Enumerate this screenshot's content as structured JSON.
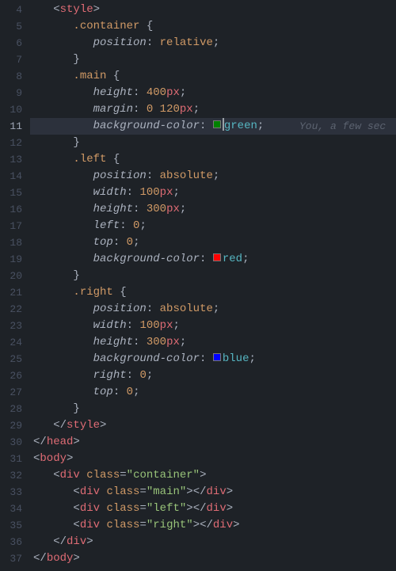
{
  "gutter": {
    "start": 4,
    "end": 37,
    "active_line": 11
  },
  "blame": {
    "text": "You, a few sec"
  },
  "lines": [
    {
      "n": 4,
      "i": 1,
      "seg": [
        [
          "t-punc",
          "<"
        ],
        [
          "t-tag",
          "style"
        ],
        [
          "t-punc",
          ">"
        ]
      ]
    },
    {
      "n": 5,
      "i": 2,
      "seg": [
        [
          "t-sel",
          ".container"
        ],
        [
          "t-punc",
          " {"
        ]
      ]
    },
    {
      "n": 6,
      "i": 3,
      "seg": [
        [
          "t-prop",
          "position"
        ],
        [
          "t-punc",
          ": "
        ],
        [
          "t-val",
          "relative"
        ],
        [
          "t-punc",
          ";"
        ]
      ]
    },
    {
      "n": 7,
      "i": 2,
      "seg": [
        [
          "t-punc",
          "}"
        ]
      ]
    },
    {
      "n": 8,
      "i": 2,
      "seg": [
        [
          "t-sel",
          ".main"
        ],
        [
          "t-punc",
          " {"
        ]
      ]
    },
    {
      "n": 9,
      "i": 3,
      "seg": [
        [
          "t-prop",
          "height"
        ],
        [
          "t-punc",
          ": "
        ],
        [
          "t-num",
          "400"
        ],
        [
          "t-unit",
          "px"
        ],
        [
          "t-punc",
          ";"
        ]
      ]
    },
    {
      "n": 10,
      "i": 3,
      "seg": [
        [
          "t-prop",
          "margin"
        ],
        [
          "t-punc",
          ": "
        ],
        [
          "t-num",
          "0 120"
        ],
        [
          "t-unit",
          "px"
        ],
        [
          "t-punc",
          ";"
        ]
      ]
    },
    {
      "n": 11,
      "i": 3,
      "highlight": true,
      "seg": [
        [
          "t-prop",
          "background-color"
        ],
        [
          "t-punc",
          ": "
        ],
        [
          "swatch",
          "sw-green"
        ],
        [
          "cursor",
          ""
        ],
        [
          "t-color",
          "green"
        ],
        [
          "t-punc",
          ";"
        ]
      ],
      "blame": true
    },
    {
      "n": 12,
      "i": 2,
      "seg": [
        [
          "t-punc",
          "}"
        ]
      ]
    },
    {
      "n": 13,
      "i": 2,
      "seg": [
        [
          "t-sel",
          ".left"
        ],
        [
          "t-punc",
          " {"
        ]
      ]
    },
    {
      "n": 14,
      "i": 3,
      "seg": [
        [
          "t-prop",
          "position"
        ],
        [
          "t-punc",
          ": "
        ],
        [
          "t-val",
          "absolute"
        ],
        [
          "t-punc",
          ";"
        ]
      ]
    },
    {
      "n": 15,
      "i": 3,
      "seg": [
        [
          "t-prop",
          "width"
        ],
        [
          "t-punc",
          ": "
        ],
        [
          "t-num",
          "100"
        ],
        [
          "t-unit",
          "px"
        ],
        [
          "t-punc",
          ";"
        ]
      ]
    },
    {
      "n": 16,
      "i": 3,
      "seg": [
        [
          "t-prop",
          "height"
        ],
        [
          "t-punc",
          ": "
        ],
        [
          "t-num",
          "300"
        ],
        [
          "t-unit",
          "px"
        ],
        [
          "t-punc",
          ";"
        ]
      ]
    },
    {
      "n": 17,
      "i": 3,
      "seg": [
        [
          "t-prop",
          "left"
        ],
        [
          "t-punc",
          ": "
        ],
        [
          "t-num",
          "0"
        ],
        [
          "t-punc",
          ";"
        ]
      ]
    },
    {
      "n": 18,
      "i": 3,
      "seg": [
        [
          "t-prop",
          "top"
        ],
        [
          "t-punc",
          ": "
        ],
        [
          "t-num",
          "0"
        ],
        [
          "t-punc",
          ";"
        ]
      ]
    },
    {
      "n": 19,
      "i": 3,
      "seg": [
        [
          "t-prop",
          "background-color"
        ],
        [
          "t-punc",
          ": "
        ],
        [
          "swatch",
          "sw-red"
        ],
        [
          "t-color",
          "red"
        ],
        [
          "t-punc",
          ";"
        ]
      ]
    },
    {
      "n": 20,
      "i": 2,
      "seg": [
        [
          "t-punc",
          "}"
        ]
      ]
    },
    {
      "n": 21,
      "i": 2,
      "seg": [
        [
          "t-sel",
          ".right"
        ],
        [
          "t-punc",
          " {"
        ]
      ]
    },
    {
      "n": 22,
      "i": 3,
      "seg": [
        [
          "t-prop",
          "position"
        ],
        [
          "t-punc",
          ": "
        ],
        [
          "t-val",
          "absolute"
        ],
        [
          "t-punc",
          ";"
        ]
      ]
    },
    {
      "n": 23,
      "i": 3,
      "seg": [
        [
          "t-prop",
          "width"
        ],
        [
          "t-punc",
          ": "
        ],
        [
          "t-num",
          "100"
        ],
        [
          "t-unit",
          "px"
        ],
        [
          "t-punc",
          ";"
        ]
      ]
    },
    {
      "n": 24,
      "i": 3,
      "seg": [
        [
          "t-prop",
          "height"
        ],
        [
          "t-punc",
          ": "
        ],
        [
          "t-num",
          "300"
        ],
        [
          "t-unit",
          "px"
        ],
        [
          "t-punc",
          ";"
        ]
      ]
    },
    {
      "n": 25,
      "i": 3,
      "seg": [
        [
          "t-prop",
          "background-color"
        ],
        [
          "t-punc",
          ": "
        ],
        [
          "swatch",
          "sw-blue"
        ],
        [
          "t-color",
          "blue"
        ],
        [
          "t-punc",
          ";"
        ]
      ]
    },
    {
      "n": 26,
      "i": 3,
      "seg": [
        [
          "t-prop",
          "right"
        ],
        [
          "t-punc",
          ": "
        ],
        [
          "t-num",
          "0"
        ],
        [
          "t-punc",
          ";"
        ]
      ]
    },
    {
      "n": 27,
      "i": 3,
      "seg": [
        [
          "t-prop",
          "top"
        ],
        [
          "t-punc",
          ": "
        ],
        [
          "t-num",
          "0"
        ],
        [
          "t-punc",
          ";"
        ]
      ]
    },
    {
      "n": 28,
      "i": 2,
      "seg": [
        [
          "t-punc",
          "}"
        ]
      ]
    },
    {
      "n": 29,
      "i": 1,
      "seg": [
        [
          "t-punc",
          "</"
        ],
        [
          "t-tag",
          "style"
        ],
        [
          "t-punc",
          ">"
        ]
      ]
    },
    {
      "n": 30,
      "i": 0,
      "seg": [
        [
          "t-punc",
          "</"
        ],
        [
          "t-tag",
          "head"
        ],
        [
          "t-punc",
          ">"
        ]
      ]
    },
    {
      "n": 31,
      "i": 0,
      "seg": [
        [
          "t-punc",
          "<"
        ],
        [
          "t-tag",
          "body"
        ],
        [
          "t-punc",
          ">"
        ]
      ]
    },
    {
      "n": 32,
      "i": 1,
      "seg": [
        [
          "t-punc",
          "<"
        ],
        [
          "t-tag",
          "div"
        ],
        [
          "t-punc",
          " "
        ],
        [
          "t-attr",
          "class"
        ],
        [
          "t-punc",
          "="
        ],
        [
          "t-str",
          "\"container\""
        ],
        [
          "t-punc",
          ">"
        ]
      ]
    },
    {
      "n": 33,
      "i": 2,
      "seg": [
        [
          "t-punc",
          "<"
        ],
        [
          "t-tag",
          "div"
        ],
        [
          "t-punc",
          " "
        ],
        [
          "t-attr",
          "class"
        ],
        [
          "t-punc",
          "="
        ],
        [
          "t-str",
          "\"main\""
        ],
        [
          "t-punc",
          "></"
        ],
        [
          "t-tag",
          "div"
        ],
        [
          "t-punc",
          ">"
        ]
      ]
    },
    {
      "n": 34,
      "i": 2,
      "seg": [
        [
          "t-punc",
          "<"
        ],
        [
          "t-tag",
          "div"
        ],
        [
          "t-punc",
          " "
        ],
        [
          "t-attr",
          "class"
        ],
        [
          "t-punc",
          "="
        ],
        [
          "t-str",
          "\"left\""
        ],
        [
          "t-punc",
          "></"
        ],
        [
          "t-tag",
          "div"
        ],
        [
          "t-punc",
          ">"
        ]
      ]
    },
    {
      "n": 35,
      "i": 2,
      "seg": [
        [
          "t-punc",
          "<"
        ],
        [
          "t-tag",
          "div"
        ],
        [
          "t-punc",
          " "
        ],
        [
          "t-attr",
          "class"
        ],
        [
          "t-punc",
          "="
        ],
        [
          "t-str",
          "\"right\""
        ],
        [
          "t-punc",
          "></"
        ],
        [
          "t-tag",
          "div"
        ],
        [
          "t-punc",
          ">"
        ]
      ]
    },
    {
      "n": 36,
      "i": 1,
      "seg": [
        [
          "t-punc",
          "</"
        ],
        [
          "t-tag",
          "div"
        ],
        [
          "t-punc",
          ">"
        ]
      ]
    },
    {
      "n": 37,
      "i": 0,
      "seg": [
        [
          "t-punc",
          "</"
        ],
        [
          "t-tag",
          "body"
        ],
        [
          "t-punc",
          ">"
        ]
      ]
    }
  ]
}
